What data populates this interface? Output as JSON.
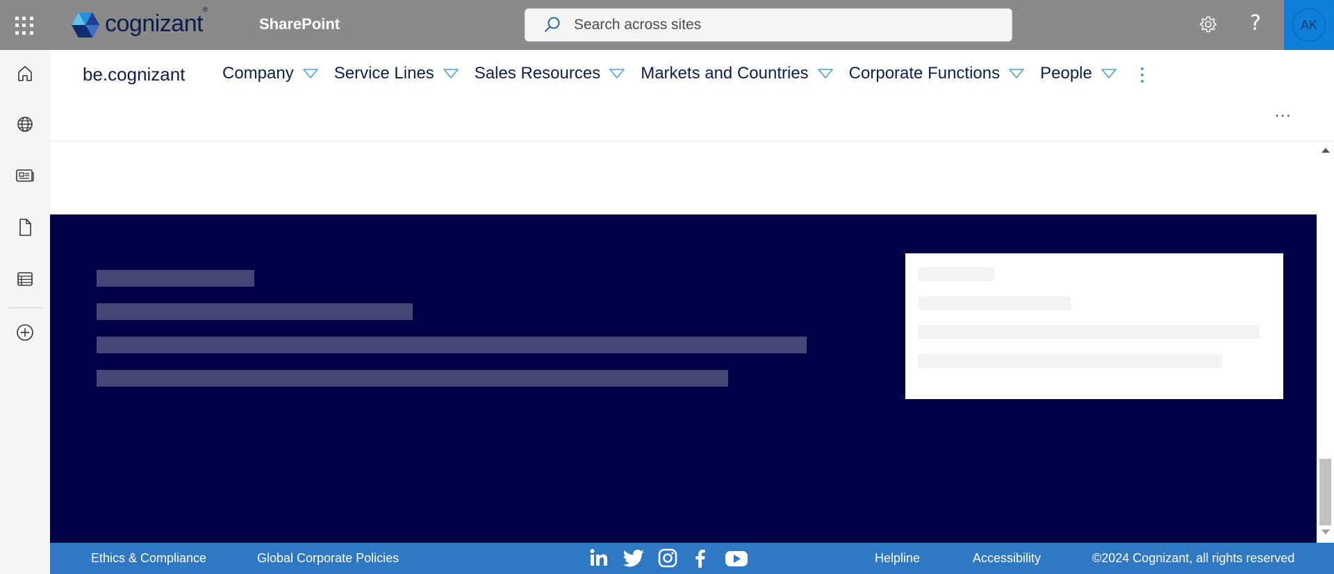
{
  "topbar": {
    "brand": "cognizant",
    "brand_mark": "®",
    "app_name": "SharePoint",
    "search_placeholder": "Search across sites",
    "user_initials": "AK",
    "help_glyph": "?",
    "icons": [
      "app-launcher-icon",
      "search-icon",
      "gear-icon",
      "help-icon"
    ]
  },
  "rail": {
    "items": [
      "home-icon",
      "globe-icon",
      "news-icon",
      "document-icon",
      "list-icon",
      "add-icon"
    ]
  },
  "site": {
    "title": "be.cognizant",
    "nav": [
      {
        "label": "Company"
      },
      {
        "label": "Service Lines"
      },
      {
        "label": "Sales Resources"
      },
      {
        "label": "Markets and Countries"
      },
      {
        "label": "Corporate Functions"
      },
      {
        "label": "People"
      }
    ],
    "more_label": "..."
  },
  "footer": {
    "links_left": [
      "Ethics & Compliance",
      "Global Corporate Policies"
    ],
    "social": [
      "linkedin-icon",
      "twitter-icon",
      "instagram-icon",
      "facebook-icon",
      "youtube-icon"
    ],
    "links_right": [
      "Helpline",
      "Accessibility"
    ],
    "copyright": "©2024 Cognizant, all rights reserved"
  },
  "colors": {
    "topbar": "#8a8a8a",
    "brand_navy": "#0c1f4c",
    "accent_blue": "#0f7fd9",
    "dark_band": "#000046",
    "skeleton": "#474777",
    "footer": "#2f78c4"
  }
}
